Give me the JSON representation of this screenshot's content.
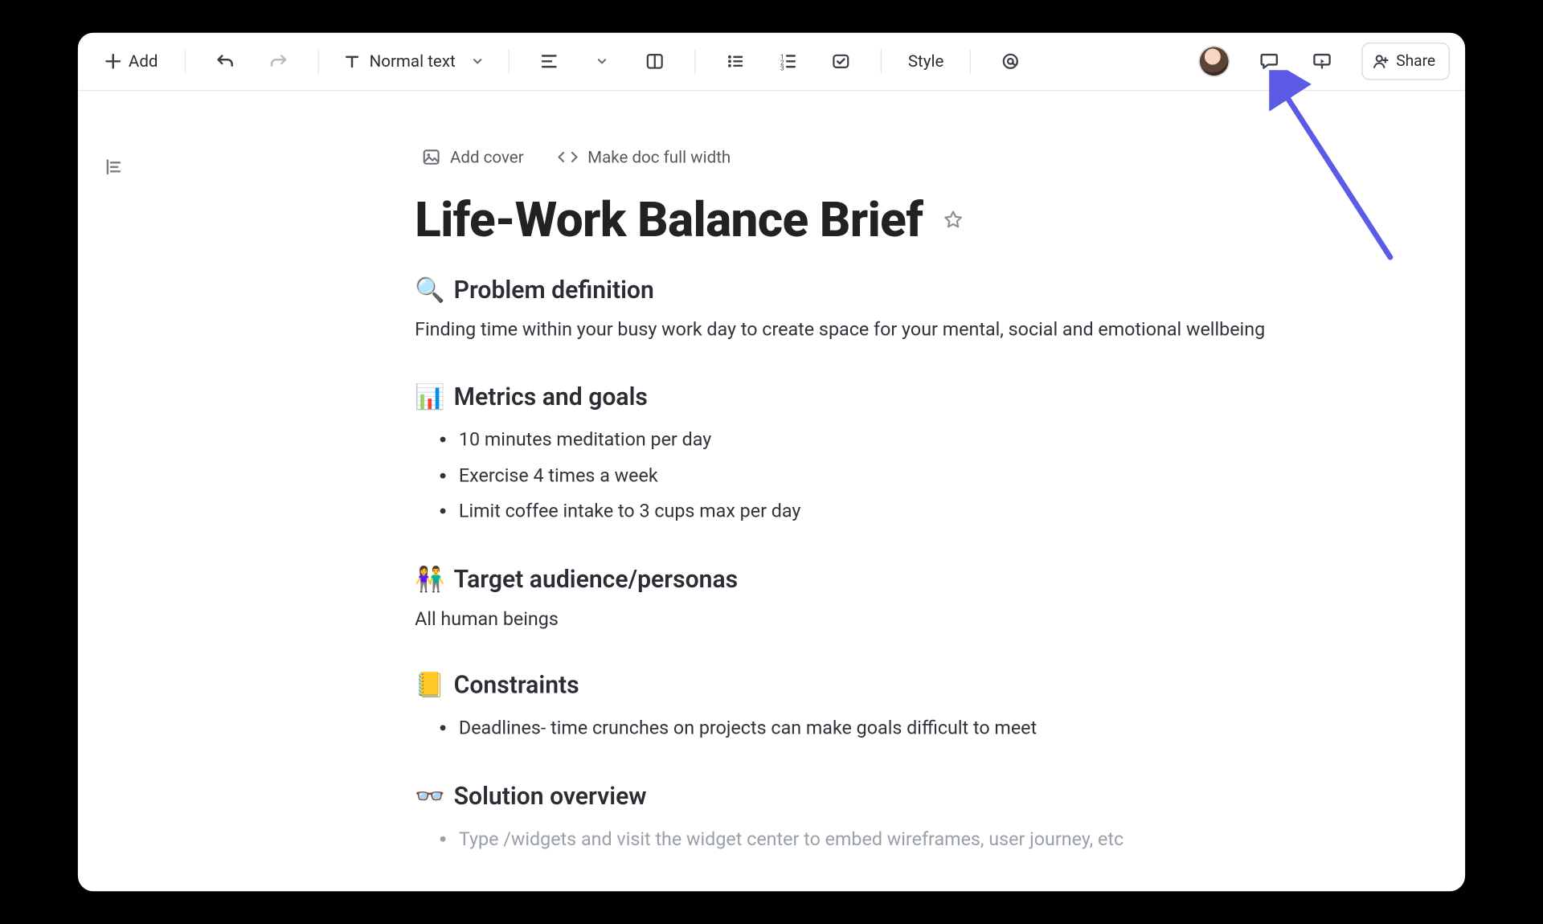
{
  "toolbar": {
    "add_label": "Add",
    "text_style_label": "Normal text",
    "style_label": "Style",
    "share_label": "Share"
  },
  "doc_actions": {
    "add_cover_label": "Add cover",
    "full_width_label": "Make doc full width"
  },
  "title": "Life-Work Balance Brief",
  "sections": [
    {
      "emoji": "🔍",
      "heading": "Problem definition",
      "paragraph": "Finding time within your busy work day to create space for your mental, social and emotional wellbeing"
    },
    {
      "emoji": "📊",
      "heading": "Metrics and goals",
      "bullets": [
        "10 minutes meditation per day",
        "Exercise 4 times a week",
        "Limit coffee intake to 3 cups max per day"
      ]
    },
    {
      "emoji": "👫",
      "heading": "Target audience/personas",
      "paragraph": "All human beings"
    },
    {
      "emoji": "📒",
      "heading": "Constraints",
      "bullets": [
        "Deadlines- time crunches on projects can make goals difficult to meet"
      ]
    },
    {
      "emoji": "👓",
      "heading": "Solution overview",
      "bullets_placeholder": [
        "Type /widgets and visit the widget center to embed wireframes, user journey, etc"
      ]
    }
  ]
}
